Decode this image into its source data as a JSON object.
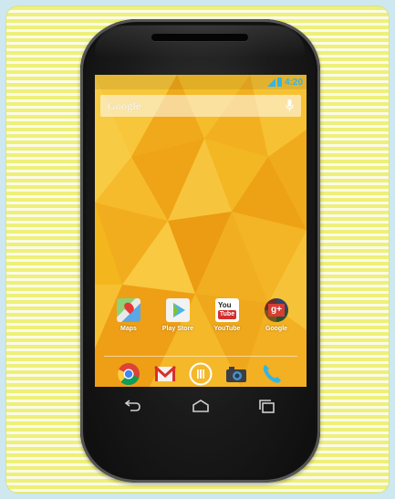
{
  "status": {
    "time": "4:20",
    "icons": [
      "signal-icon",
      "battery-icon"
    ],
    "color": "#33b5e5"
  },
  "search": {
    "label": "Google",
    "icon": "mic-icon"
  },
  "home_apps": [
    {
      "label": "Maps",
      "icon": "maps-icon"
    },
    {
      "label": "Play Store",
      "icon": "play-store-icon"
    },
    {
      "label": "YouTube",
      "icon": "youtube-icon"
    },
    {
      "label": "Google",
      "icon": "google-plus-icon"
    }
  ],
  "dock": [
    {
      "icon": "chrome-icon"
    },
    {
      "icon": "gmail-icon"
    },
    {
      "icon": "app-drawer-icon"
    },
    {
      "icon": "camera-icon"
    },
    {
      "icon": "phone-icon"
    }
  ],
  "navbar": [
    "back-icon",
    "home-icon",
    "recents-icon"
  ],
  "colors": {
    "wallpaper": "#f2b318",
    "stripe": "#eef07a",
    "accent": "#33b5e5"
  }
}
